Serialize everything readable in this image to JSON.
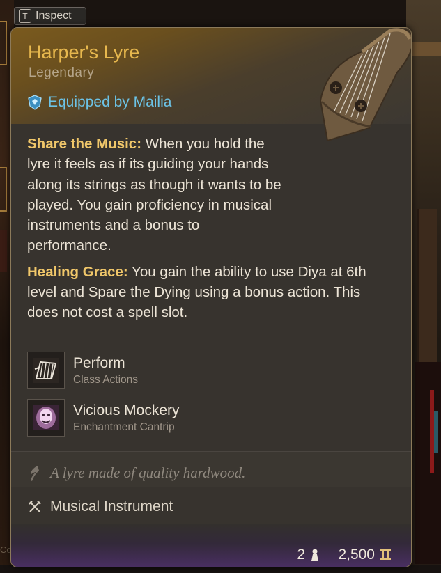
{
  "inspect": {
    "key": "T",
    "label": "Inspect"
  },
  "item": {
    "name": "Harper's Lyre",
    "rarity": "Legendary",
    "equipped_label": "Equipped by Mailia",
    "descriptions": [
      {
        "title": "Share the Music:",
        "text": " When you hold the lyre it feels as if its guiding your hands along its strings as though it wants to be played. You gain proficiency in musical instruments and a bonus to performance."
      },
      {
        "title": "Healing Grace:",
        "text": " You gain the ability to use Diya at 6th level and Spare the Dying using a bonus action. This does not cost a spell slot."
      }
    ],
    "actions": [
      {
        "name": "Perform",
        "subtitle": "Class Actions",
        "icon": "perform-icon"
      },
      {
        "name": "Vicious Mockery",
        "subtitle": "Enchantment Cantrip",
        "icon": "vicious-mockery-icon"
      }
    ],
    "flavor": "A lyre made of quality hardwood.",
    "type": "Musical Instrument",
    "weight": "2",
    "value": "2,500"
  },
  "background": {
    "corner_text": "Co"
  },
  "colors": {
    "title": "#e7b84e",
    "equipped": "#6cc3e6",
    "accent_title": "#f0c76a",
    "footer_purple": "#4a2f63"
  }
}
